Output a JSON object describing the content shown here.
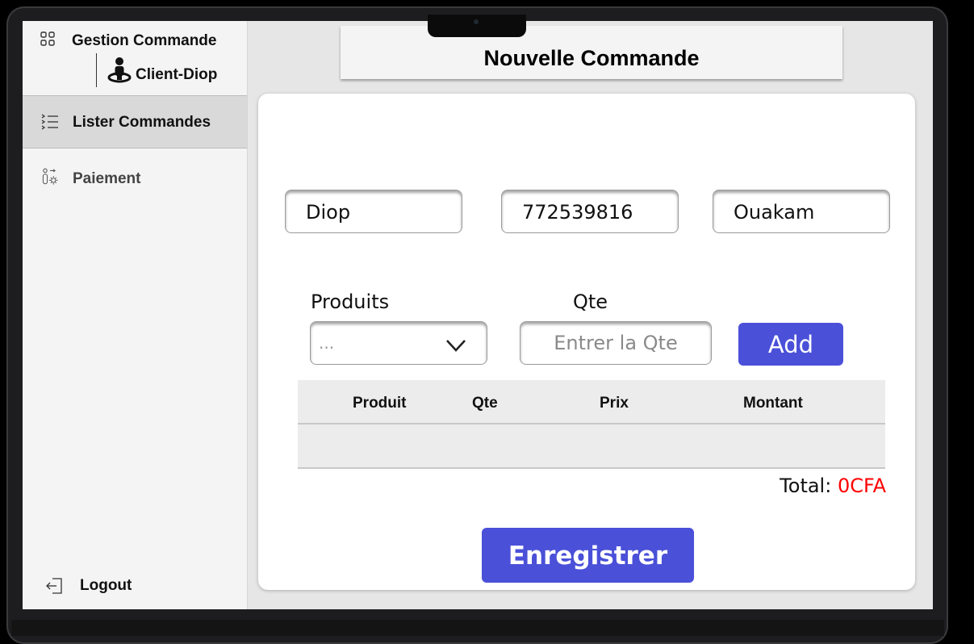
{
  "sidebar": {
    "app_title": "Gestion Commande",
    "app_icon": "grid-icon",
    "client_name": "Client-Diop",
    "client_icon": "user-location-icon",
    "items": [
      {
        "label": "Lister Commandes",
        "icon": "list-icon",
        "active": true
      },
      {
        "label": "Paiement",
        "icon": "user-settings-icon",
        "active": false
      }
    ],
    "logout": {
      "label": "Logout",
      "icon": "logout-icon"
    }
  },
  "header": {
    "title": "Nouvelle Commande"
  },
  "form": {
    "client_fields": [
      "Diop",
      "772539816",
      "Ouakam"
    ],
    "produits_label": "Produits",
    "produits_selected": "...",
    "qte_label": "Qte",
    "qte_placeholder": "Entrer la Qte",
    "add_label": "Add"
  },
  "table": {
    "columns": [
      "Produit",
      "Qte",
      "Prix",
      "Montant"
    ],
    "rows": []
  },
  "total": {
    "label": "Total:",
    "value": "0CFA"
  },
  "save_label": "Enregistrer",
  "colors": {
    "accent": "#4a50d8",
    "total_value": "#ff0000"
  }
}
